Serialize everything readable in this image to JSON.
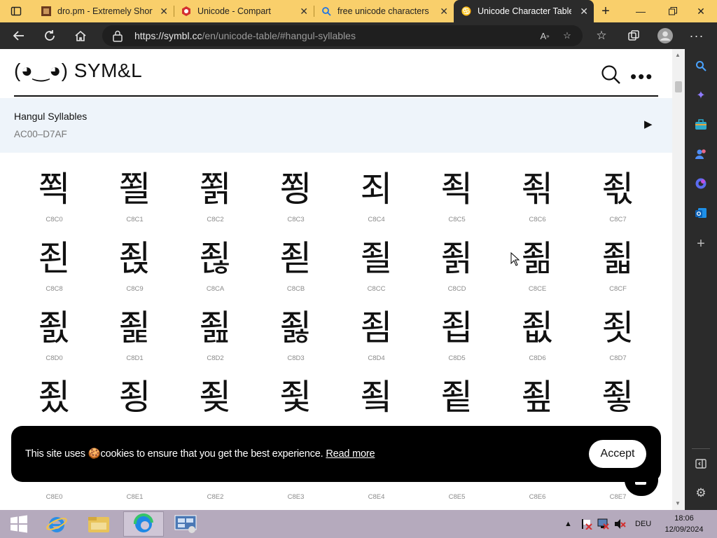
{
  "browser": {
    "tabs": [
      {
        "title": "dro.pm - Extremely Short",
        "icon": "dropm-favicon"
      },
      {
        "title": "Unicode - Compart",
        "icon": "compart-favicon"
      },
      {
        "title": "free unicode characters -",
        "icon": "search-favicon"
      },
      {
        "title": "Unicode Character Table",
        "icon": "symbl-favicon",
        "active": true
      }
    ],
    "url_host": "https://symbl.cc",
    "url_path": "/en/unicode-table/#hangul-syllables"
  },
  "site": {
    "brand": "(◕‿◕) SYM&L"
  },
  "block": {
    "name": "Hangul Syllables",
    "range": "AC00–D7AF"
  },
  "grid": [
    {
      "char": "쬑",
      "code": "C8C0"
    },
    {
      "char": "쬘",
      "code": "C8C1"
    },
    {
      "char": "쬙",
      "code": "C8C2"
    },
    {
      "char": "쬥",
      "code": "C8C3"
    },
    {
      "char": "죄",
      "code": "C8C4"
    },
    {
      "char": "죅",
      "code": "C8C5"
    },
    {
      "char": "죆",
      "code": "C8C6"
    },
    {
      "char": "죇",
      "code": "C8C7"
    },
    {
      "char": "죈",
      "code": "C8C8"
    },
    {
      "char": "죉",
      "code": "C8C9"
    },
    {
      "char": "죊",
      "code": "C8CA"
    },
    {
      "char": "죋",
      "code": "C8CB"
    },
    {
      "char": "죌",
      "code": "C8CC"
    },
    {
      "char": "죍",
      "code": "C8CD"
    },
    {
      "char": "죎",
      "code": "C8CE"
    },
    {
      "char": "죏",
      "code": "C8CF"
    },
    {
      "char": "죐",
      "code": "C8D0"
    },
    {
      "char": "죑",
      "code": "C8D1"
    },
    {
      "char": "죒",
      "code": "C8D2"
    },
    {
      "char": "죓",
      "code": "C8D3"
    },
    {
      "char": "죔",
      "code": "C8D4"
    },
    {
      "char": "죕",
      "code": "C8D5"
    },
    {
      "char": "죖",
      "code": "C8D6"
    },
    {
      "char": "죗",
      "code": "C8D7"
    },
    {
      "char": "죘",
      "code": ""
    },
    {
      "char": "죙",
      "code": ""
    },
    {
      "char": "죚",
      "code": ""
    },
    {
      "char": "죛",
      "code": ""
    },
    {
      "char": "죜",
      "code": ""
    },
    {
      "char": "죝",
      "code": ""
    },
    {
      "char": "죞",
      "code": ""
    },
    {
      "char": "죟",
      "code": ""
    },
    {
      "char": "",
      "code": "C8E0"
    },
    {
      "char": "",
      "code": "C8E1"
    },
    {
      "char": "",
      "code": "C8E2"
    },
    {
      "char": "",
      "code": "C8E3"
    },
    {
      "char": "",
      "code": "C8E4"
    },
    {
      "char": "",
      "code": "C8E5"
    },
    {
      "char": "",
      "code": "C8E6"
    },
    {
      "char": "",
      "code": "C8E7"
    }
  ],
  "cookie": {
    "text": "This site uses 🍪cookies to ensure that you get the best experience.",
    "link": "Read more",
    "accept": "Accept"
  },
  "taskbar": {
    "lang": "DEU",
    "time": "18:06",
    "date": "12/09/2024"
  },
  "colors": {
    "tab_strip": "#f9cf6b",
    "chrome_dark": "#2b2b2b",
    "block_bg": "#eef4fa",
    "taskbar": "#b5aabd"
  }
}
